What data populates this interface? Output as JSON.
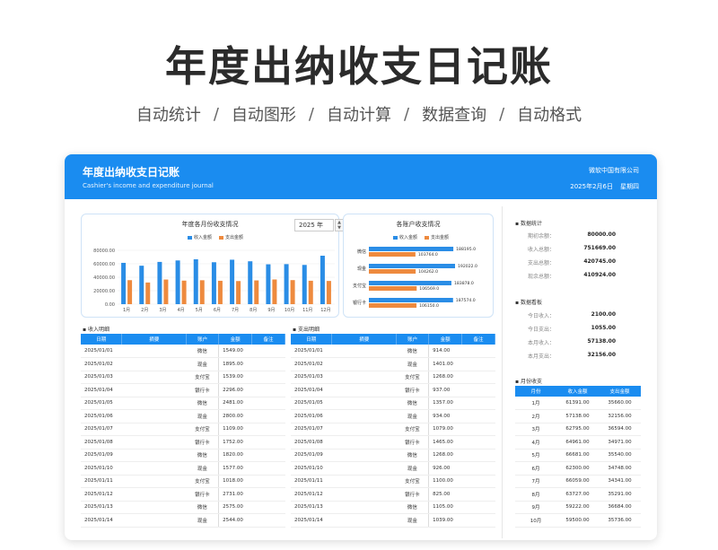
{
  "hero": {
    "title": "年度出纳收支日记账",
    "features": [
      "自动统计",
      "自动图形",
      "自动计算",
      "数据查询",
      "自动格式"
    ]
  },
  "header": {
    "title": "年度出纳收支日记账",
    "subtitle": "Cashier's income and expenditure journal",
    "company": "微软中国有限公司",
    "date": "2025年2月6日",
    "weekday": "星期四"
  },
  "colors": {
    "accent": "#1a8cf0",
    "income": "#2a8de6",
    "expense": "#ee8a3e"
  },
  "year_select": {
    "value": "2025 年"
  },
  "chart_data": [
    {
      "type": "bar",
      "title": "年度各月份收支情况",
      "categories": [
        "1月",
        "2月",
        "3月",
        "4月",
        "5月",
        "6月",
        "7月",
        "8月",
        "9月",
        "10月",
        "11月",
        "12月"
      ],
      "series": [
        {
          "name": "收入金额",
          "values": [
            61391,
            57138,
            62795,
            64961,
            66681,
            62300,
            66059,
            63727,
            59222,
            59500,
            58300,
            72000
          ]
        },
        {
          "name": "支出金额",
          "values": [
            35660,
            32156,
            36594,
            34971,
            35540,
            34748,
            34341,
            35291,
            36684,
            35736,
            34800,
            34500
          ]
        }
      ],
      "yticks": [
        "0.00",
        "20000.00",
        "40000.00",
        "60000.00",
        "80000.00"
      ],
      "ylim": [
        0,
        80000
      ],
      "legend": "top"
    },
    {
      "type": "bar",
      "orientation": "horizontal",
      "title": "各账户收支情况",
      "categories": [
        "微信",
        "现金",
        "支付宝",
        "银行卡"
      ],
      "series": [
        {
          "name": "收入金额",
          "values": [
            188195.0,
            192022.0,
            183878.0,
            187574.0
          ]
        },
        {
          "name": "支出金额",
          "values": [
            103764.0,
            104262.0,
            106569.0,
            106150.0
          ]
        }
      ],
      "legend": "top"
    }
  ],
  "income": {
    "label": "收入明细",
    "columns": [
      "日期",
      "摘要",
      "账户",
      "金额",
      "备注"
    ],
    "rows": [
      [
        "2025/01/01",
        "微信",
        "1549.00"
      ],
      [
        "2025/01/02",
        "现金",
        "1895.00"
      ],
      [
        "2025/01/03",
        "支付宝",
        "1539.00"
      ],
      [
        "2025/01/04",
        "银行卡",
        "2296.00"
      ],
      [
        "2025/01/05",
        "微信",
        "2481.00"
      ],
      [
        "2025/01/06",
        "现金",
        "2800.00"
      ],
      [
        "2025/01/07",
        "支付宝",
        "1109.00"
      ],
      [
        "2025/01/08",
        "银行卡",
        "1752.00"
      ],
      [
        "2025/01/09",
        "微信",
        "1820.00"
      ],
      [
        "2025/01/10",
        "现金",
        "1577.00"
      ],
      [
        "2025/01/11",
        "支付宝",
        "1018.00"
      ],
      [
        "2025/01/12",
        "银行卡",
        "2731.00"
      ],
      [
        "2025/01/13",
        "微信",
        "2575.00"
      ],
      [
        "2025/01/14",
        "现金",
        "2544.00"
      ]
    ]
  },
  "expense": {
    "label": "支出明细",
    "columns": [
      "日期",
      "摘要",
      "账户",
      "金额",
      "备注"
    ],
    "rows": [
      [
        "2025/01/01",
        "微信",
        "914.00"
      ],
      [
        "2025/01/02",
        "现金",
        "1401.00"
      ],
      [
        "2025/01/03",
        "支付宝",
        "1268.00"
      ],
      [
        "2025/01/04",
        "银行卡",
        "937.00"
      ],
      [
        "2025/01/05",
        "微信",
        "1357.00"
      ],
      [
        "2025/01/06",
        "现金",
        "934.00"
      ],
      [
        "2025/01/07",
        "支付宝",
        "1079.00"
      ],
      [
        "2025/01/08",
        "银行卡",
        "1465.00"
      ],
      [
        "2025/01/09",
        "微信",
        "1268.00"
      ],
      [
        "2025/01/10",
        "现金",
        "926.00"
      ],
      [
        "2025/01/11",
        "支付宝",
        "1100.00"
      ],
      [
        "2025/01/12",
        "银行卡",
        "825.00"
      ],
      [
        "2025/01/13",
        "微信",
        "1105.00"
      ],
      [
        "2025/01/14",
        "现金",
        "1039.00"
      ]
    ]
  },
  "stats": {
    "label": "数据统计",
    "items": [
      {
        "k": "期初余额：",
        "v": "80000.00"
      },
      {
        "k": "收入总额：",
        "v": "751669.00"
      },
      {
        "k": "支出总额：",
        "v": "420745.00"
      },
      {
        "k": "现余总额：",
        "v": "410924.00"
      }
    ]
  },
  "board": {
    "label": "数据看板",
    "items": [
      {
        "k": "今日收入：",
        "v": "2100.00"
      },
      {
        "k": "今日支出：",
        "v": "1055.00"
      },
      {
        "k": "本月收入：",
        "v": "57138.00"
      },
      {
        "k": "本月支出：",
        "v": "32156.00"
      }
    ]
  },
  "monthly": {
    "label": "月份收支",
    "columns": [
      "月份",
      "收入金额",
      "支出金额"
    ],
    "rows": [
      [
        "1月",
        "61391.00",
        "35660.00"
      ],
      [
        "2月",
        "57138.00",
        "32156.00"
      ],
      [
        "3月",
        "62795.00",
        "36594.00"
      ],
      [
        "4月",
        "64961.00",
        "34971.00"
      ],
      [
        "5月",
        "66681.00",
        "35540.00"
      ],
      [
        "6月",
        "62300.00",
        "34748.00"
      ],
      [
        "7月",
        "66059.00",
        "34341.00"
      ],
      [
        "8月",
        "63727.00",
        "35291.00"
      ],
      [
        "9月",
        "59222.00",
        "36684.00"
      ],
      [
        "10月",
        "59500.00",
        "35736.00"
      ]
    ]
  }
}
